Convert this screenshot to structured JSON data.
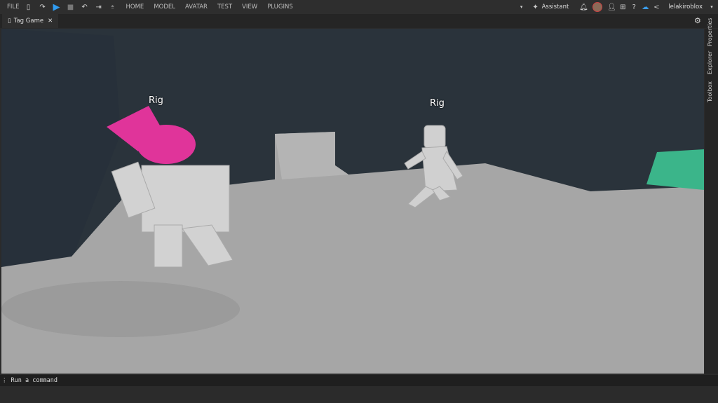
{
  "menu": {
    "file": "FILE",
    "tabs": [
      "HOME",
      "MODEL",
      "AVATAR",
      "TEST",
      "VIEW",
      "PLUGINS"
    ],
    "assistant": "Assistant",
    "username": "lelakiroblox"
  },
  "tab": {
    "title": "Tag Game"
  },
  "side_tabs": [
    "Properties",
    "Explorer",
    "Toolbox"
  ],
  "scene": {
    "labels": [
      "Rig",
      "Rig"
    ]
  },
  "command": {
    "placeholder": "Run a command"
  },
  "colors": {
    "play": "#2f9bf0",
    "hair": "#e0349a",
    "floor": "#a8a8a8",
    "wall": "#2a333b",
    "green": "#3bb58a"
  }
}
